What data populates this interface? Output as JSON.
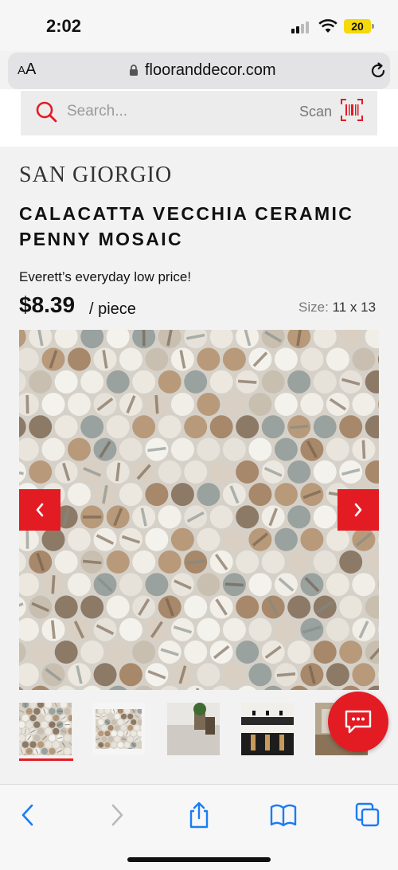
{
  "status_bar": {
    "time": "2:02",
    "battery": "20",
    "battery_color": "#f5d90a"
  },
  "url_bar": {
    "aa_label_small": "A",
    "aa_label_large": "A",
    "url": "flooranddecor.com",
    "icons": [
      "lock-icon",
      "reload-icon"
    ]
  },
  "search": {
    "placeholder": "Search...",
    "scan_label": "Scan",
    "icons": [
      "search-icon",
      "barcode-icon"
    ]
  },
  "product": {
    "brand": "SAN GIORGIO",
    "title": "CALACATTA VECCHIA CERAMIC PENNY MOSAIC",
    "price_note": "Everett’s everyday low price!",
    "price": "$8.39",
    "price_unit": "/ piece",
    "size_label": "Size:",
    "size_value": "11 x 13"
  },
  "gallery": {
    "thumbnail_count": 5,
    "active_thumbnail": 1,
    "icons": [
      "chevron-left-icon",
      "chevron-right-icon"
    ]
  },
  "chat": {
    "icon": "chat-bubble-icon"
  },
  "toolbar": {
    "icons": [
      "back-icon",
      "forward-icon",
      "share-icon",
      "bookmarks-icon",
      "tabs-icon"
    ]
  },
  "colors": {
    "brand_red": "#e31b23",
    "ios_blue": "#1a7cf5"
  }
}
